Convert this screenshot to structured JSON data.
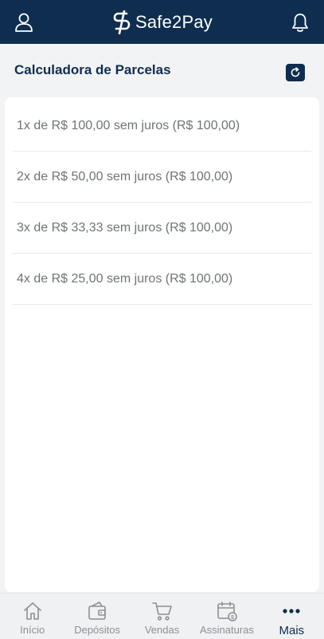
{
  "header": {
    "brand": "Safe2Pay",
    "profile_icon": "user-icon",
    "notification_icon": "bell-icon"
  },
  "section": {
    "title": "Calculadora de Parcelas",
    "refresh_icon": "refresh-icon"
  },
  "installments": [
    {
      "text": "1x de R$  100,00 sem juros (R$  100,00)"
    },
    {
      "text": "2x de R$  50,00 sem juros (R$  100,00)"
    },
    {
      "text": "3x de R$  33,33 sem juros (R$  100,00)"
    },
    {
      "text": "4x de R$  25,00 sem juros (R$  100,00)"
    }
  ],
  "bottom_nav": {
    "items": [
      {
        "label": "Início",
        "icon": "home-icon"
      },
      {
        "label": "Depósitos",
        "icon": "wallet-icon"
      },
      {
        "label": "Vendas",
        "icon": "cart-icon"
      },
      {
        "label": "Assinaturas",
        "icon": "calendar-icon"
      },
      {
        "label": "Mais",
        "icon": "more-icon"
      }
    ],
    "active_index": 4
  },
  "colors": {
    "brand": "#0f2d4f",
    "text_muted": "#6f7377",
    "nav_inactive": "#8c9096"
  }
}
